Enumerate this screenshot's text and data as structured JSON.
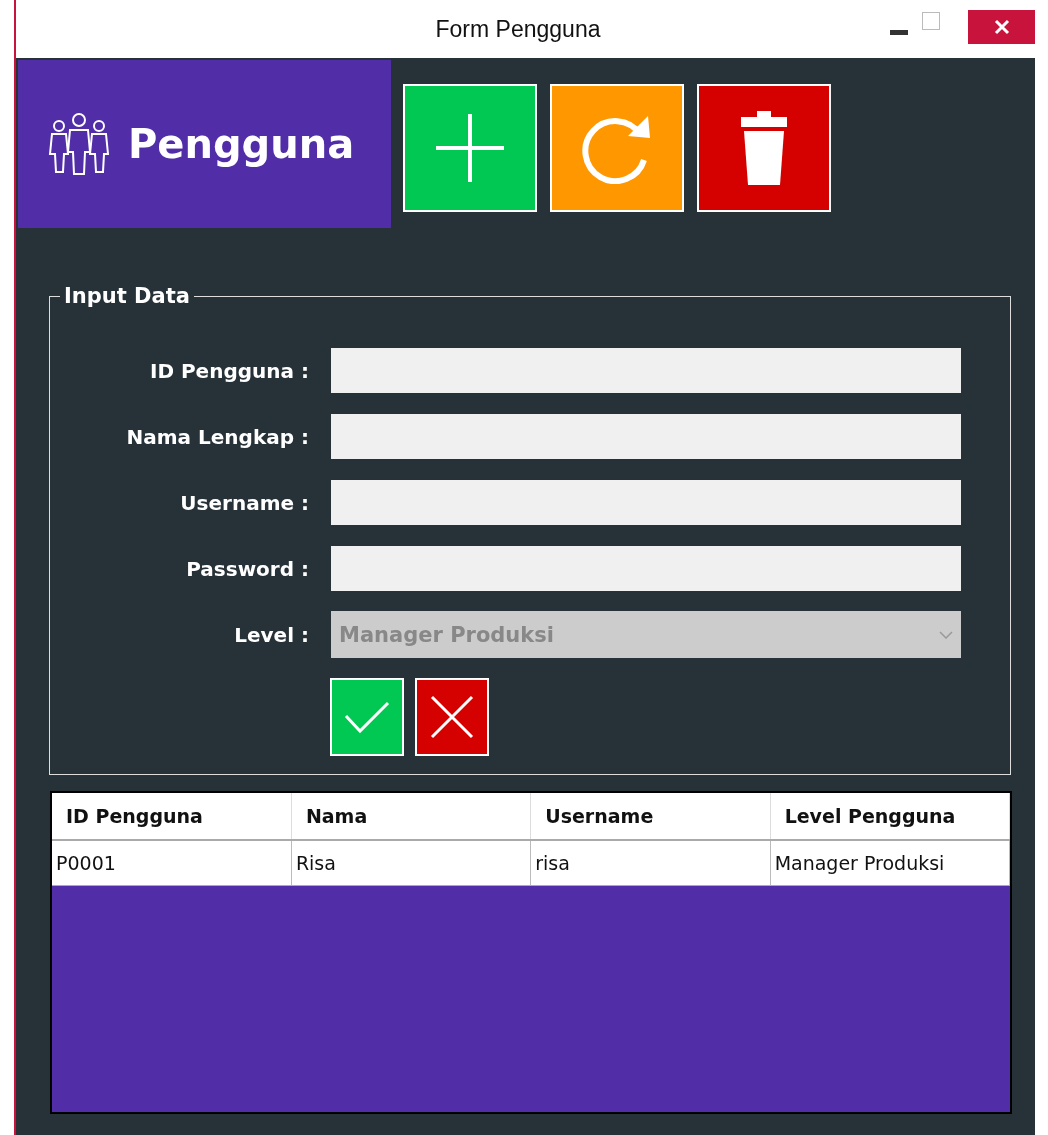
{
  "window": {
    "title": "Form Pengguna"
  },
  "header": {
    "title": "Pengguna"
  },
  "toolbar": [
    {
      "kind": "add"
    },
    {
      "kind": "refresh"
    },
    {
      "kind": "delete"
    }
  ],
  "form": {
    "legend": "Input Data",
    "fields": [
      {
        "label": "ID Pengguna :",
        "kind": "text"
      },
      {
        "label": "Nama Lengkap :",
        "kind": "text"
      },
      {
        "label": "Username :",
        "kind": "text"
      },
      {
        "label": "Password :",
        "kind": "password"
      },
      {
        "label": "Level :",
        "kind": "dropdown",
        "value": "Manager Produksi",
        "disabled": true
      }
    ],
    "actions": [
      {
        "kind": "confirm"
      },
      {
        "kind": "cancel"
      }
    ]
  },
  "table": {
    "columns": [
      "ID Pengguna",
      "Nama",
      "Username",
      "Level Pengguna"
    ],
    "rows": [
      [
        "P0001",
        "Risa",
        "risa",
        "Manager Produksi"
      ]
    ]
  }
}
